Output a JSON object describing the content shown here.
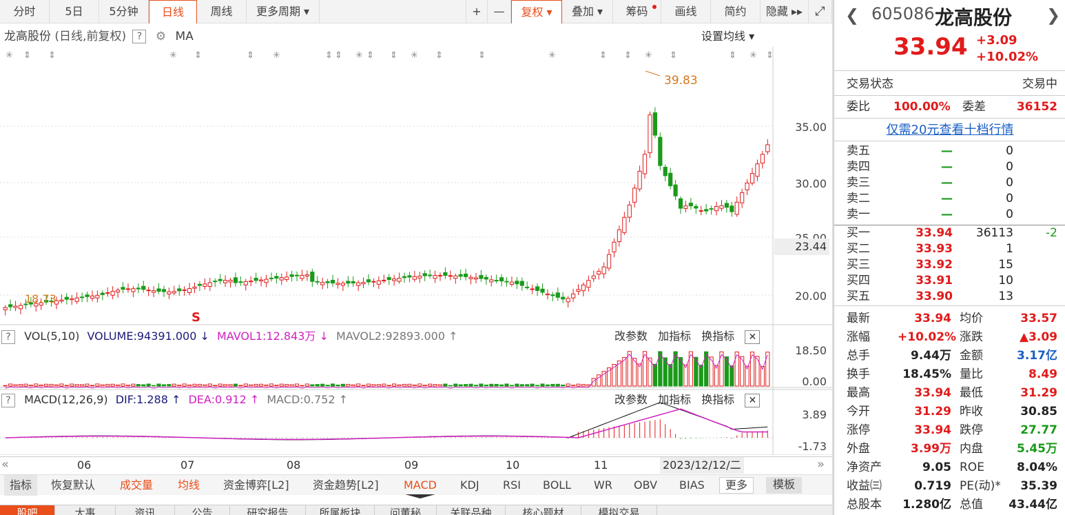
{
  "toolbar": {
    "tabs": [
      "分时",
      "5日",
      "5分钟",
      "日线",
      "周线",
      "更多周期 ▾"
    ],
    "right": [
      "+",
      "—",
      "复权 ▾",
      "叠加 ▾",
      "筹码",
      "画线",
      "简约",
      "隐藏 ▸▸"
    ]
  },
  "chart": {
    "title": "龙高股份",
    "subtitle": "(日线,前复权)",
    "q": "?",
    "ma": "MA",
    "set_ma": "设置均线 ▾",
    "high_label": "39.83",
    "low_label": "18.73",
    "cursor_value": "23.44",
    "y_labels": [
      "35.00",
      "30.00",
      "25.00",
      "20.00"
    ],
    "x_labels": [
      "06",
      "07",
      "08",
      "09",
      "10",
      "11"
    ],
    "date_label": "2023/12/12/二",
    "s_mark": "S"
  },
  "vol": {
    "q": "?",
    "name": "VOL(5,10)",
    "volume": "VOLUME:94391.000 ↓",
    "mavol1": "MAVOL1:12.843万 ↓",
    "mavol2": "MAVOL2:92893.000 ↑",
    "buttons": [
      "改参数",
      "加指标",
      "换指标"
    ],
    "close": "✕",
    "y_labels": [
      "18.50",
      "0.00"
    ]
  },
  "macd": {
    "q": "?",
    "name": "MACD(12,26,9)",
    "dif": "DIF:1.288 ↑",
    "dea": "DEA:0.912 ↑",
    "macd": "MACD:0.752 ↑",
    "buttons": [
      "改参数",
      "加指标",
      "换指标"
    ],
    "close": "✕",
    "y_labels": [
      "3.89",
      "-1.73"
    ]
  },
  "bottom": {
    "items": [
      "指标",
      "恢复默认",
      "成交量",
      "均线",
      "资金博弈[L2]",
      "资金趋势[L2]",
      "MACD",
      "KDJ",
      "RSI",
      "BOLL",
      "WR",
      "OBV",
      "BIAS",
      "更多",
      "模板"
    ]
  },
  "tabs2": [
    "股吧",
    "大事",
    "资讯",
    "公告",
    "研究报告",
    "所属板块",
    "问董秘",
    "关联品种",
    "核心题材",
    "模拟交易"
  ],
  "quote": {
    "code": "605086",
    "name": "龙高股份",
    "price": "33.94",
    "change": "+3.09",
    "pct": "+10.02%",
    "status_label": "交易状态",
    "status_value": "交易中",
    "wb_label": "委比",
    "wb_value": "100.00%",
    "wc_label": "委差",
    "wc_value": "36152",
    "promo": "仅需20元查看十档行情",
    "sells": [
      {
        "label": "卖五",
        "price": "—",
        "vol": "0"
      },
      {
        "label": "卖四",
        "price": "—",
        "vol": "0"
      },
      {
        "label": "卖三",
        "price": "—",
        "vol": "0"
      },
      {
        "label": "卖二",
        "price": "—",
        "vol": "0"
      },
      {
        "label": "卖一",
        "price": "—",
        "vol": "0"
      }
    ],
    "buys": [
      {
        "label": "买一",
        "price": "33.94",
        "vol": "36113",
        "chg": "-2"
      },
      {
        "label": "买二",
        "price": "33.93",
        "vol": "1",
        "chg": ""
      },
      {
        "label": "买三",
        "price": "33.92",
        "vol": "15",
        "chg": ""
      },
      {
        "label": "买四",
        "price": "33.91",
        "vol": "10",
        "chg": ""
      },
      {
        "label": "买五",
        "price": "33.90",
        "vol": "13",
        "chg": ""
      }
    ],
    "stats": [
      {
        "l1": "最新",
        "v1": "33.94",
        "c1": "red",
        "l2": "均价",
        "v2": "33.57",
        "c2": "red"
      },
      {
        "l1": "涨幅",
        "v1": "+10.02%",
        "c1": "red",
        "l2": "涨跌",
        "v2": "▲3.09",
        "c2": "red"
      },
      {
        "l1": "总手",
        "v1": "9.44万",
        "c1": "dark",
        "l2": "金额",
        "v2": "3.17亿",
        "c2": "blue"
      },
      {
        "l1": "换手",
        "v1": "18.45%",
        "c1": "dark",
        "l2": "量比",
        "v2": "8.49",
        "c2": "red"
      },
      {
        "l1": "最高",
        "v1": "33.94",
        "c1": "red",
        "l2": "最低",
        "v2": "31.29",
        "c2": "red"
      },
      {
        "l1": "今开",
        "v1": "31.29",
        "c1": "red",
        "l2": "昨收",
        "v2": "30.85",
        "c2": "dark"
      },
      {
        "l1": "涨停",
        "v1": "33.94",
        "c1": "red",
        "l2": "跌停",
        "v2": "27.77",
        "c2": "green"
      },
      {
        "l1": "外盘",
        "v1": "3.99万",
        "c1": "red",
        "l2": "内盘",
        "v2": "5.45万",
        "c2": "green"
      },
      {
        "l1": "净资产",
        "v1": "9.05",
        "c1": "dark",
        "l2": "ROE",
        "v2": "8.04%",
        "c2": "dark"
      },
      {
        "l1": "收益㈢",
        "v1": "0.719",
        "c1": "dark",
        "l2": "PE(动)*",
        "v2": "35.39",
        "c2": "dark"
      },
      {
        "l1": "总股本",
        "v1": "1.280亿",
        "c1": "dark",
        "l2": "总值",
        "v2": "43.44亿",
        "c2": "dark"
      }
    ]
  },
  "colors": {
    "up": "#e01b1b",
    "down": "#1a9a1a",
    "accent": "#e94e1b",
    "mavol1": "#d020c0"
  }
}
